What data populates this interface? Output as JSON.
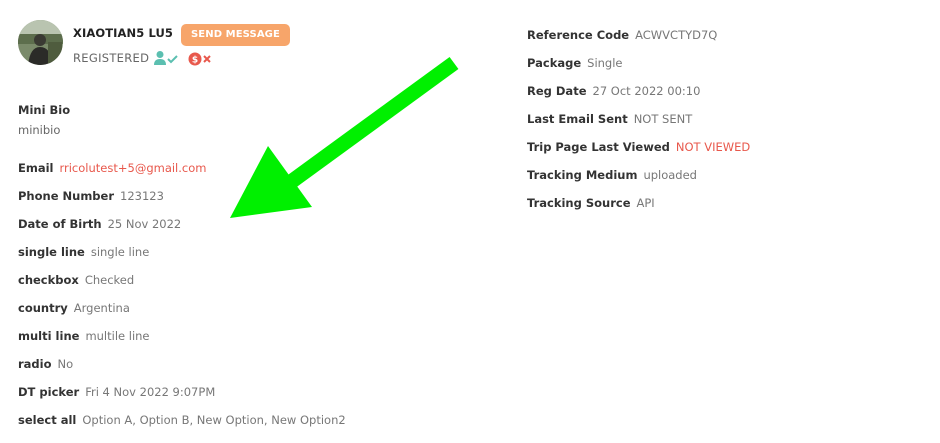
{
  "profile": {
    "name": "XIAOTIAN5 LU5",
    "send_message_label": "SEND MESSAGE",
    "status": "REGISTERED",
    "icons": [
      "avatar-photo",
      "person-check-icon",
      "payment-x-icon"
    ],
    "colors": {
      "accent_orange": "#f7a56a",
      "teal": "#5bbfb0",
      "red": "#e8584c",
      "arrow_green": "#00f000"
    }
  },
  "bio": {
    "title": "Mini Bio",
    "text": "minibio"
  },
  "left_fields": [
    {
      "label": "Email",
      "value": "rricolutest+5@gmail.com"
    },
    {
      "label": "Phone Number",
      "value": "123123"
    },
    {
      "label": "Date of Birth",
      "value": "25 Nov 2022"
    },
    {
      "label": "single line",
      "value": "single line"
    },
    {
      "label": "checkbox",
      "value": "Checked"
    },
    {
      "label": "country",
      "value": "Argentina"
    },
    {
      "label": "multi line",
      "value": "multile line"
    },
    {
      "label": "radio",
      "value": "No"
    },
    {
      "label": "DT picker",
      "value": "Fri 4 Nov 2022 9:07PM"
    },
    {
      "label": "select all",
      "value": "Option A, Option B, New Option, New Option2"
    }
  ],
  "right_fields": [
    {
      "label": "Reference Code",
      "value": "ACWVCTYD7Q"
    },
    {
      "label": "Package",
      "value": "Single"
    },
    {
      "label": "Reg Date",
      "value": "27 Oct 2022 00:10"
    },
    {
      "label": "Last Email Sent",
      "value": "NOT SENT"
    },
    {
      "label": "Trip Page Last Viewed",
      "value": "NOT VIEWED"
    },
    {
      "label": "Tracking Medium",
      "value": "uploaded"
    },
    {
      "label": "Tracking Source",
      "value": "API"
    }
  ]
}
